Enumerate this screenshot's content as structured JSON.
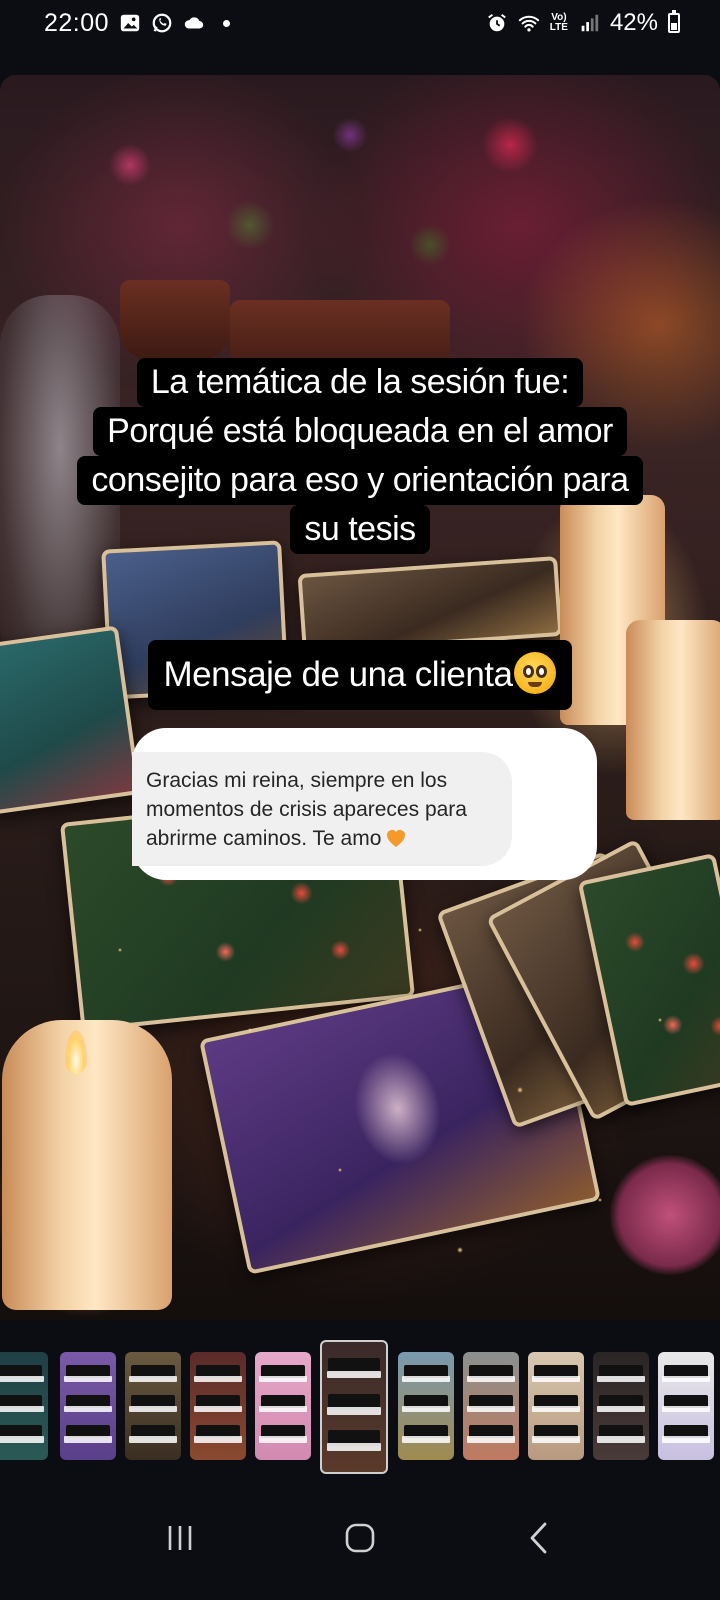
{
  "status_bar": {
    "time": "22:00",
    "lte_top": "Vo)",
    "lte_bottom": "LTE",
    "battery": "42%",
    "battery_level": 0.42,
    "icons": [
      "gallery-icon",
      "whatsapp-icon",
      "cloud-icon",
      "notification-dot-icon",
      "alarm-icon",
      "wifi-icon",
      "volte-icon",
      "signal-icon",
      "battery-icon"
    ]
  },
  "story": {
    "caption_lines": [
      "La temática de la sesión fue:",
      "Porqué está bloqueada en el amor",
      "consejito para eso y orientación para",
      "su tesis"
    ],
    "mensaje_label": "Mensaje de una clienta",
    "mensaje_emoji": "pleading-face-emoji",
    "client_message": "Gracias mi reina, siempre en los momentos de crisis apareces para abrirme caminos. Te amo",
    "client_message_emoji": "orange-heart-emoji"
  },
  "thumbnails": {
    "count": 11,
    "active_index": 5,
    "themes": [
      "teal",
      "purple",
      "gold",
      "rose",
      "pink",
      "tarot",
      "blue",
      "grey",
      "beige",
      "dark",
      "light"
    ]
  },
  "nav_bar": {
    "buttons": [
      "recents-icon",
      "home-icon",
      "back-icon"
    ]
  },
  "colors": {
    "background": "#0b0d12",
    "caption_box": "#000000",
    "caption_text": "#ffffff",
    "bubble_bg": "#f0f0f0",
    "heart": "#f39a2a"
  }
}
